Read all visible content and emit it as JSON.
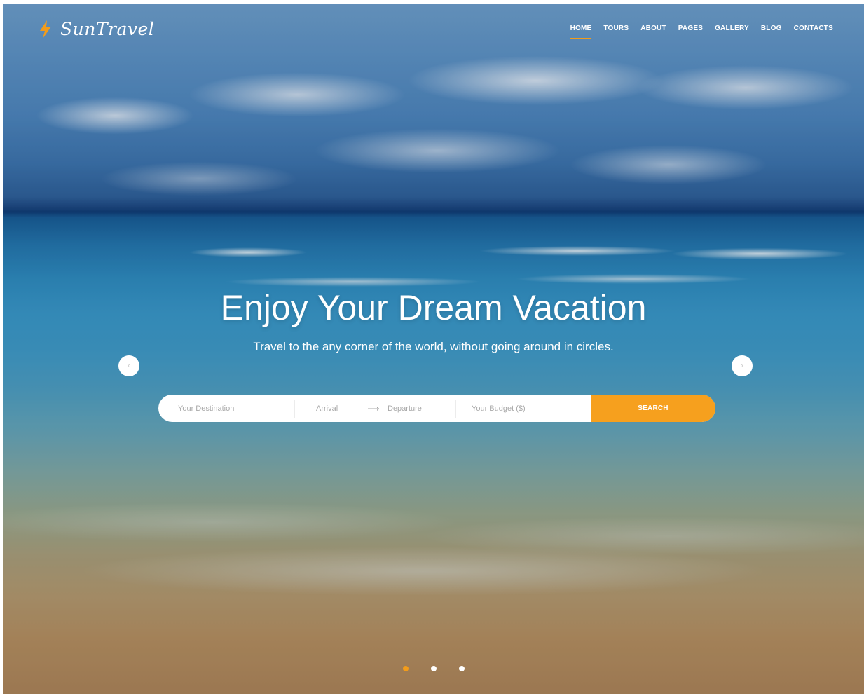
{
  "brand": {
    "name": "SunTravel",
    "accent": "#f39c1a"
  },
  "nav": {
    "items": [
      {
        "label": "HOME",
        "active": true
      },
      {
        "label": "TOURS",
        "active": false
      },
      {
        "label": "ABOUT",
        "active": false
      },
      {
        "label": "PAGES",
        "active": false
      },
      {
        "label": "GALLERY",
        "active": false
      },
      {
        "label": "BLOG",
        "active": false
      },
      {
        "label": "CONTACTS",
        "active": false
      }
    ]
  },
  "hero": {
    "title": "Enjoy Your Dream Vacation",
    "subtitle": "Travel to the any corner of the world, without going around in circles."
  },
  "slider": {
    "prev_icon": "chevron-left-icon",
    "next_icon": "chevron-right-icon",
    "prev_glyph": "‹",
    "next_glyph": "›",
    "active_slide": 1,
    "slide_count": 3
  },
  "search": {
    "destination_placeholder": "Your Destination",
    "arrival_placeholder": "Arrival",
    "arrow_glyph": "⟶",
    "departure_placeholder": "Departure",
    "budget_placeholder": "Your Budget ($)",
    "button_label": "SEARCH",
    "button_color": "#f6a01e"
  }
}
